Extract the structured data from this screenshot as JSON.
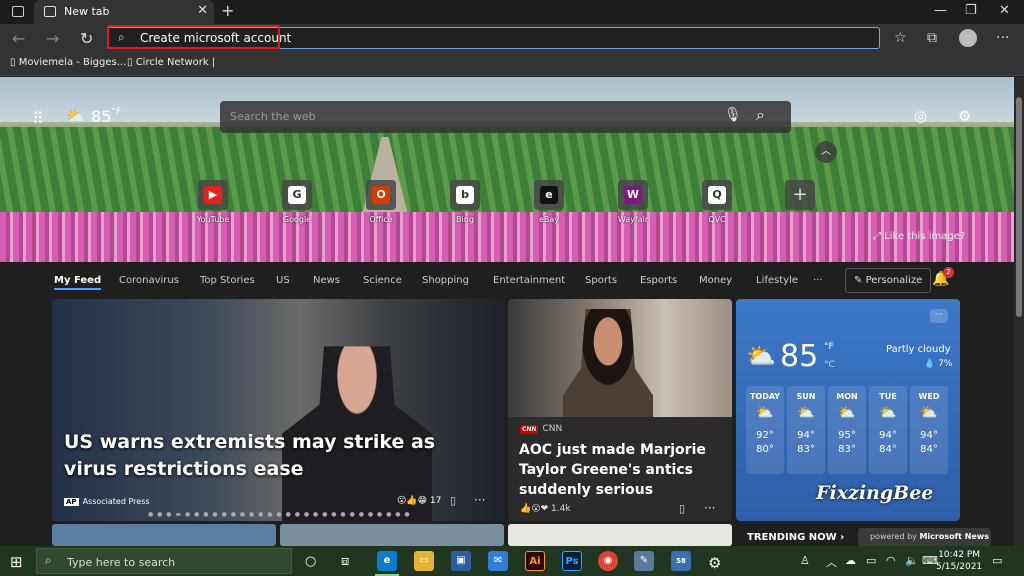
{
  "browser": {
    "tab_title": "New tab",
    "address_text": "Create microsoft account",
    "bookmarks": [
      "Moviemela - Bigges...",
      "Circle Network |"
    ]
  },
  "hero": {
    "temp": "85",
    "temp_unit": "°F",
    "search_placeholder": "Search the web",
    "like_image": "Like this image?",
    "quick_links": [
      {
        "label": "YouTube",
        "icon": "youtube-icon",
        "color": "#e62117",
        "glyph": "▶"
      },
      {
        "label": "Google",
        "icon": "google-icon",
        "color": "#ffffff",
        "glyph": "G"
      },
      {
        "label": "Office",
        "icon": "office-icon",
        "color": "#d83b01",
        "glyph": "O"
      },
      {
        "label": "Bing",
        "icon": "bing-icon",
        "color": "#ffffff",
        "glyph": "b"
      },
      {
        "label": "eBay",
        "icon": "ebay-icon",
        "color": "#111111",
        "glyph": "e"
      },
      {
        "label": "Wayfair",
        "icon": "wayfair-icon",
        "color": "#7f187f",
        "glyph": "W"
      },
      {
        "label": "QVC",
        "icon": "qvc-icon",
        "color": "#ffffff",
        "glyph": "Q"
      }
    ]
  },
  "feed": {
    "tabs": [
      "My Feed",
      "Coronavirus",
      "Top Stories",
      "US",
      "News",
      "Science",
      "Shopping",
      "Entertainment",
      "Sports",
      "Esports",
      "Money",
      "Lifestyle",
      "···"
    ],
    "personalize": "Personalize",
    "notif_count": "2"
  },
  "cards": {
    "main": {
      "headline": "US warns extremists may strike as virus restrictions ease",
      "source_logo": "AP",
      "source": "Associated Press",
      "reactions": "17"
    },
    "second": {
      "source_logo": "CNN",
      "source": "CNN",
      "headline": "AOC just made Marjorie Taylor Greene's antics suddenly serious",
      "reactions": "1.4k"
    },
    "weather": {
      "temp": "85",
      "unit_f": "°F",
      "unit_c": "°C",
      "condition": "Partly cloudy",
      "precip": "7%",
      "days": [
        {
          "day": "TODAY",
          "hi": "92°",
          "lo": "80°"
        },
        {
          "day": "SUN",
          "hi": "94°",
          "lo": "83°"
        },
        {
          "day": "MON",
          "hi": "95°",
          "lo": "83°"
        },
        {
          "day": "TUE",
          "hi": "94°",
          "lo": "84°"
        },
        {
          "day": "WED",
          "hi": "94°",
          "lo": "84°"
        }
      ],
      "watermark": "FixzingBee"
    }
  },
  "trending": {
    "label": "TRENDING NOW",
    "powered_prefix": "powered by",
    "powered_brand": "Microsoft News"
  },
  "taskbar": {
    "search_placeholder": "Type here to search",
    "time": "10:42 PM",
    "date": "5/15/2021",
    "badge": "58"
  }
}
